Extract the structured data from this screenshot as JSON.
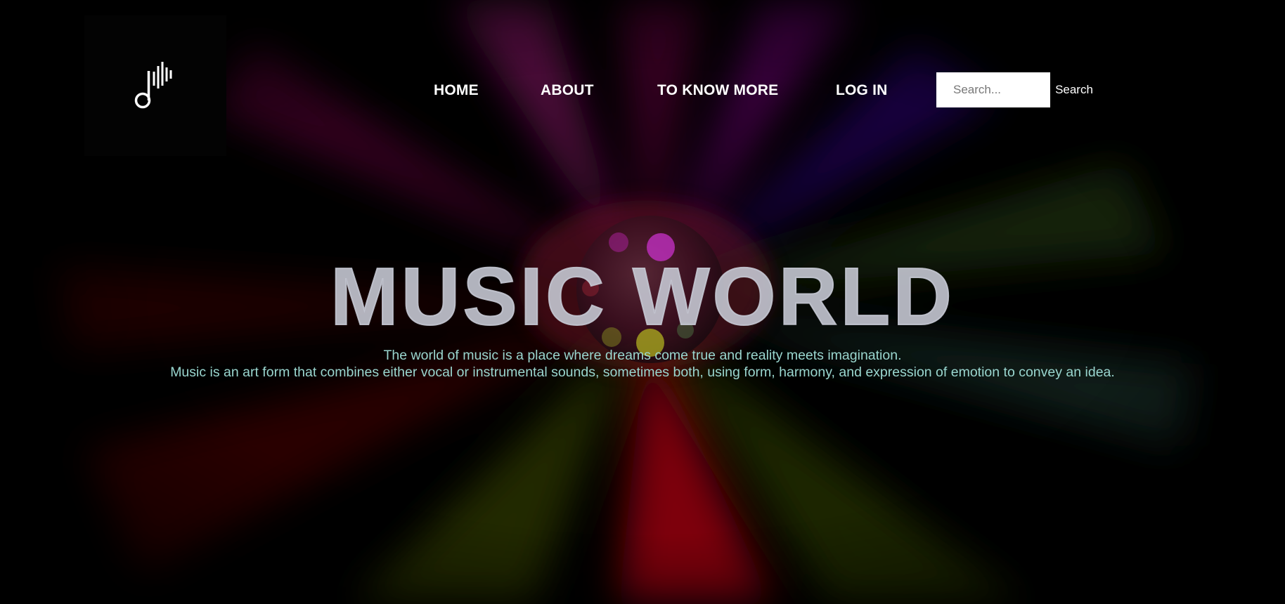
{
  "nav": {
    "items": [
      {
        "label": "HOME"
      },
      {
        "label": "ABOUT"
      },
      {
        "label": "TO KNOW MORE"
      },
      {
        "label": "LOG IN"
      }
    ]
  },
  "search": {
    "placeholder": "Search...",
    "button_label": "Search"
  },
  "hero": {
    "title": "MUSIC WORLD",
    "line1": "The world of music is a place where dreams come true and reality meets imagination.",
    "line2": "Music is an art form that combines either vocal or instrumental sounds, sometimes both, using form, harmony, and expression of emotion to convey an idea."
  },
  "logo": {
    "icon": "music-note-soundwave-icon"
  },
  "colors": {
    "background": "#000000",
    "title": "#c4c6d2",
    "body_text": "#9ad6cf",
    "nav_text": "#ffffff"
  }
}
